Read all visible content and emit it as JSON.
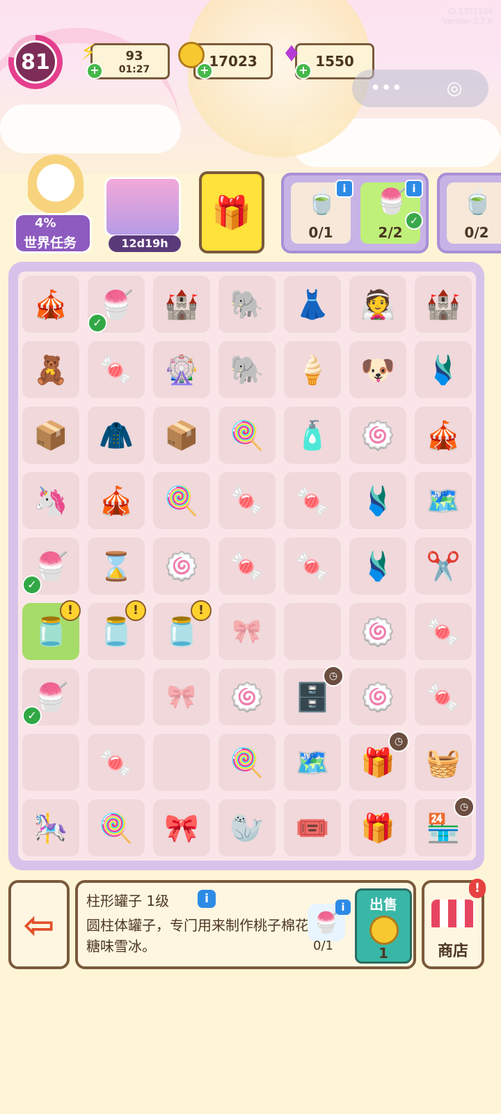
{
  "header": {
    "level": "81",
    "energy": "93",
    "energy_timer": "01:27",
    "coins": "17023",
    "gems": "1550",
    "watermark_line1": "ID 1351234",
    "watermark_line2": "Version 2.7.0"
  },
  "world_task": {
    "percent": "4%",
    "label": "世界任务"
  },
  "event": {
    "timer": "12d19h"
  },
  "orders": [
    {
      "count": "0/1",
      "done": false
    },
    {
      "count": "2/2",
      "done": true
    },
    {
      "count": "0/2",
      "done": false
    }
  ],
  "board": {
    "cells": [
      [
        "🎪",
        "🍧",
        "🏰",
        "🐘",
        "👗",
        "👰",
        "🏰"
      ],
      [
        "🧸",
        "🍬",
        "🎡",
        "🐘",
        "🍦",
        "🐶",
        "🩱"
      ],
      [
        "📦",
        "🧥",
        "📦",
        "🍭",
        "🧴",
        "🍥",
        "🎪"
      ],
      [
        "🦄",
        "🎪",
        "🍭",
        "🍬",
        "🍬",
        "🩱",
        "🗺️"
      ],
      [
        "🍧",
        "⌛",
        "🍥",
        "🍬",
        "🍬",
        "🩱",
        "✂️"
      ],
      [
        "🫙",
        "🫙",
        "🫙",
        "lock",
        "",
        "🍥",
        "🍬"
      ],
      [
        "🍧",
        "",
        "lock",
        "🍥",
        "🗄️",
        "🍥",
        "🍬"
      ],
      [
        "",
        "🍬",
        "",
        "🍭",
        "🗺️",
        "🎁",
        "🧺"
      ],
      [
        "🎠",
        "🍭",
        "🎀",
        "🦭",
        "🎟️",
        "🎁",
        "🏪"
      ]
    ]
  },
  "selected_item": {
    "name": "柱形罐子 1级",
    "description": "圆柱体罐子，专门用来制作桃子棉花糖味雪冰。",
    "target_count": "0/1",
    "sell_label": "出售",
    "sell_price": "1"
  },
  "buttons": {
    "shop_label": "商店"
  }
}
